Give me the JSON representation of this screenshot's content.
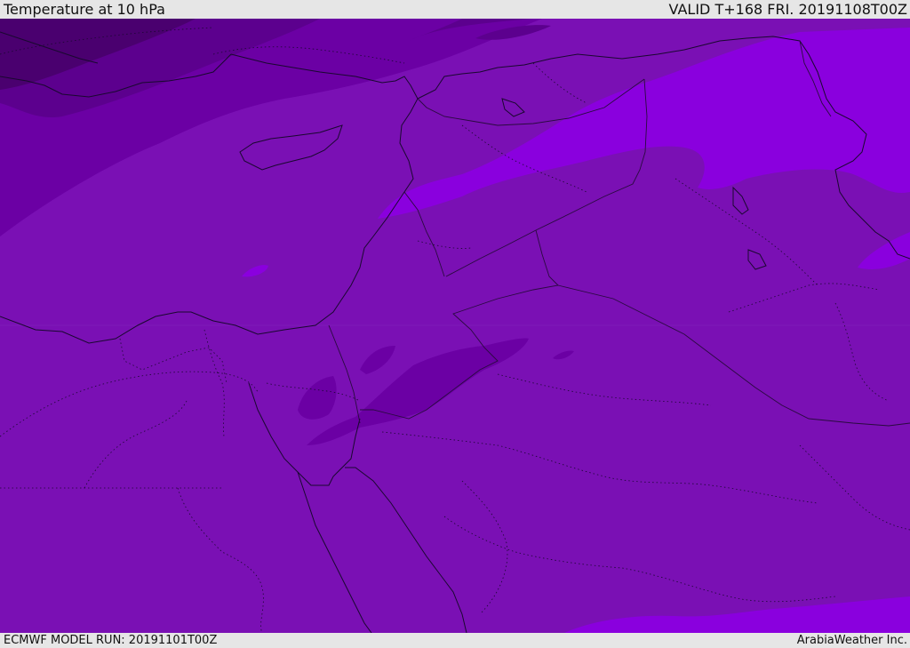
{
  "header": {
    "title": "Temperature at 10 hPa",
    "valid": "VALID T+168 FRI. 20191108T00Z"
  },
  "footer": {
    "model_run": "ECMWF MODEL RUN: 20191101T00Z",
    "credit": "ArabiaWeather Inc."
  },
  "map": {
    "colors": {
      "coldest": "#4a006f",
      "colder": "#5c008e",
      "cold": "#6b00a4",
      "base": "#7a10b4",
      "warm": "#8a00de",
      "coast": "#1a0830",
      "border": "#2a0a40"
    }
  }
}
